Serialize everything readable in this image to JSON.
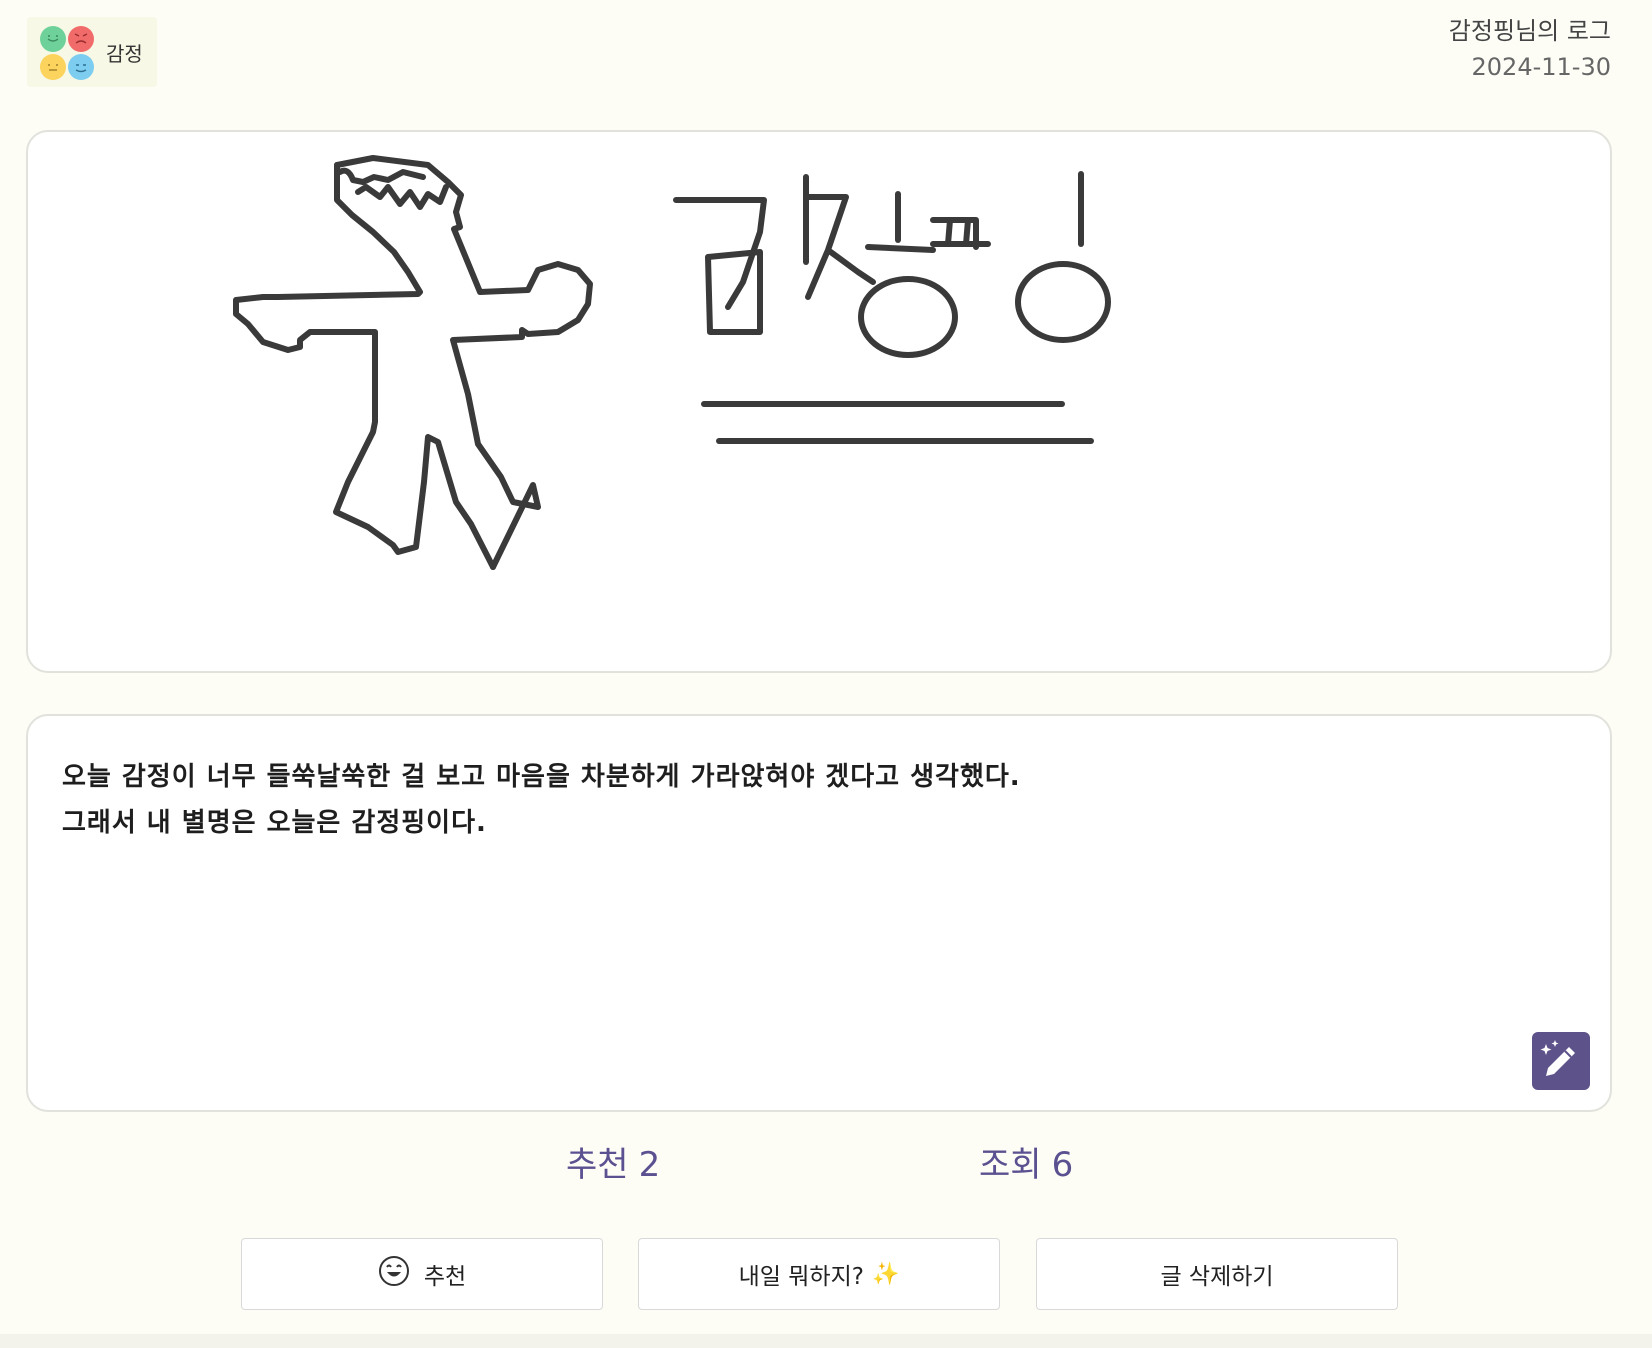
{
  "header": {
    "logo_text": "감정",
    "owner_title": "감정핑님의 로그",
    "date": "2024-11-30"
  },
  "logo_faces": [
    {
      "icon": "happy-face-icon",
      "color": "#6fd19a"
    },
    {
      "icon": "angry-face-icon",
      "color": "#f16b6b"
    },
    {
      "icon": "meh-face-icon",
      "color": "#fbd35d"
    },
    {
      "icon": "sad-face-icon",
      "color": "#7dcdf0"
    }
  ],
  "drawing": {
    "description_icon": "hand-drawn-canvas"
  },
  "diary": {
    "line1": "오늘 감정이 너무 들쑥날쑥한 걸 보고 마음을 차분하게 가라앉혀야 겠다고 생각했다.",
    "line2": "그래서 내 별명은 오늘은 감정핑이다."
  },
  "edit_button": {
    "icon": "magic-pencil-icon",
    "color": "#5d5289"
  },
  "stats": {
    "like_label": "추천",
    "like_count": "2",
    "view_label": "조회",
    "view_count": "6"
  },
  "actions": {
    "like_label": "추천",
    "like_icon": "smile-icon",
    "tomorrow_label": "내일 뭐하지?",
    "tomorrow_icon": "sparkles-icon",
    "delete_label": "글 삭제하기"
  },
  "colors": {
    "accent": "#5b5090",
    "background": "#fdfdf6"
  }
}
